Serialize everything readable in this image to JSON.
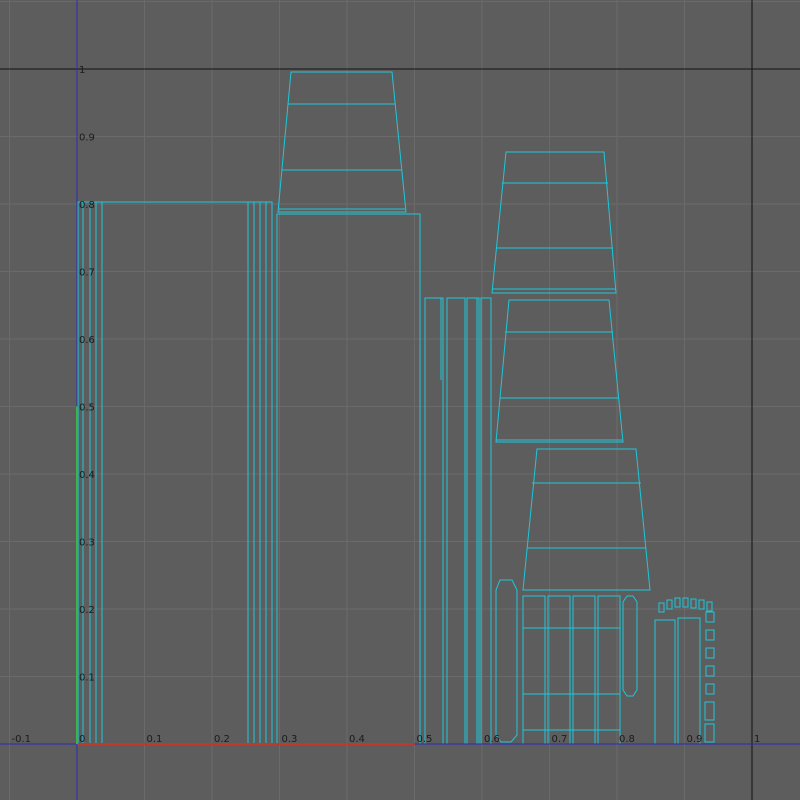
{
  "editor": {
    "panel": "UV Texture Editor",
    "background_color": "#5d5d5d",
    "grid_color": "#6a6a6a",
    "uv_shell_color": "#1fc7d9",
    "u_axis_color": "#c0392b",
    "v_axis_color": "#39b54a",
    "origin_line_color": "#2b2bb8",
    "frame_line_color": "#111111",
    "u_range": [
      -0.1,
      1.05
    ],
    "v_range": [
      -0.08,
      1.07
    ],
    "tick_labels_u": [
      "-0.1",
      "0",
      "0.1",
      "0.2",
      "0.3",
      "0.4",
      "0.5",
      "0.6",
      "0.7",
      "0.8",
      "0.9",
      "1"
    ],
    "tick_labels_v": [
      "0.1",
      "0.2",
      "0.3",
      "0.4",
      "0.5",
      "0.6",
      "0.7",
      "0.8",
      "0.9",
      "1"
    ]
  }
}
